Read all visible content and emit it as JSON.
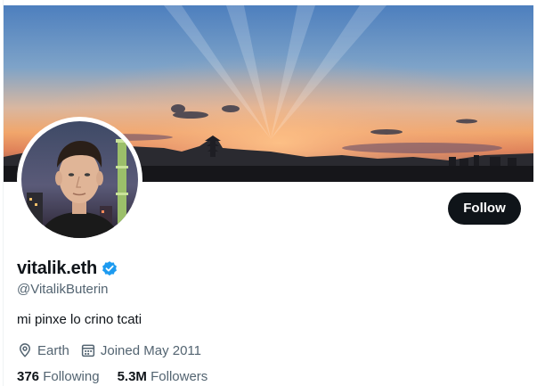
{
  "profile": {
    "display_name": "vitalik.eth",
    "handle": "@VitalikButerin",
    "bio": "mi pinxe lo crino tcati",
    "location": "Earth",
    "joined": "Joined May 2011",
    "verified": true
  },
  "actions": {
    "follow_label": "Follow"
  },
  "stats": {
    "following_count": "376",
    "following_label": "Following",
    "followers_count": "5.3M",
    "followers_label": "Followers"
  },
  "icons": {
    "verified": "verified-badge-icon",
    "location": "location-pin-icon",
    "calendar": "calendar-icon"
  },
  "colors": {
    "verified_blue": "#1d9bf0",
    "button_bg": "#0f1419",
    "secondary_text": "#536471"
  }
}
